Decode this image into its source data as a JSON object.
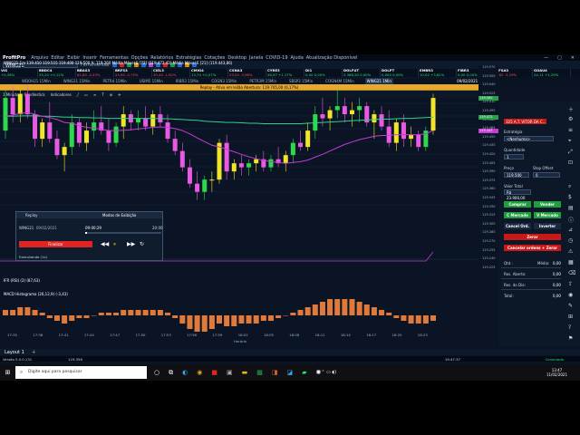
{
  "app": {
    "name": "ProfitPro",
    "menu": [
      "Arquivo",
      "Editar",
      "Exibir",
      "Inserir",
      "Ferramentas",
      "Opções",
      "Relatórios",
      "Estratégias",
      "Cotações",
      "Desktop",
      "Janela",
      "COVID-19",
      "Ajuda",
      "Atualização Disponível"
    ]
  },
  "toolbar": {
    "asset_value": "WING21",
    "workspace_label": "Ferramentas"
  },
  "ticker": [
    {
      "symbol": "VIS",
      "value": "+0,36%",
      "dir": "up"
    },
    {
      "symbol": "BBDC4",
      "value": "25,20 +0,12%",
      "dir": "up"
    },
    {
      "symbol": "BBAS3",
      "value": "62,80 -0,43%",
      "dir": "dn"
    },
    {
      "symbol": "BRFS3",
      "value": "23,90 -0,75%",
      "dir": "dn"
    },
    {
      "symbol": "CIEL3",
      "value": "30,40 -1,62%",
      "dir": "dn"
    },
    {
      "symbol": "CMIG4",
      "value": "13,74 +0,07%",
      "dir": "up"
    },
    {
      "symbol": "CSNA3",
      "value": "23,02 -3,98%",
      "dir": "dn"
    },
    {
      "symbol": "CYRE3",
      "value": "28,97 +1,17%",
      "dir": "up"
    },
    {
      "symbol": "DI1",
      "value": "0,00 0,00%",
      "dir": "up"
    },
    {
      "symbol": "DOLFUT",
      "value": "5.368,50 0,00%",
      "dir": "up"
    },
    {
      "symbol": "DOLPT",
      "value": "0,000 0,00%",
      "dir": "up"
    },
    {
      "symbol": "EMBR3",
      "value": "10,02 +3,62%",
      "dir": "up"
    },
    {
      "symbol": "FIBR3",
      "value": "0,00 0,00%",
      "dir": "up"
    },
    {
      "symbol": "GFSA3",
      "value": "5,62 -3,29%",
      "dir": "dn"
    },
    {
      "symbol": "GOAU4",
      "value": "24,11 +2,29%",
      "dir": "up"
    }
  ],
  "tabs": [
    "WDOH21 15Min",
    "WING21 15Min",
    "PETR4 15Min",
    "USIM5 15Min",
    "IRBR3 15Min",
    "COGN3 15Min",
    "PETR3M 15Min",
    "SBSP3 15Min",
    "COGN4M 15Min",
    "WING21 1Min"
  ],
  "active_tab": 9,
  "clock_header": "09/02/2021 10:24",
  "banner": "Replay - Ativo em leilão  Abertura: 119.705,00 (0,17%)",
  "chart_toolbar": {
    "interval": "1 Minuto",
    "style": "Candlestick",
    "indicators": "Indicadores"
  },
  "legend": "WING21 1m  119.410  119.515  119.400  119.500  A: 119.260  Média Móvel E [72]  (119.472,42)  Média Móvel E [21]  (119.443,86)",
  "price_labels": [
    "119.570",
    "119.555",
    "119.540",
    "119.525",
    "119.510",
    "119.495",
    "119.480",
    "119.465",
    "119.450",
    "119.435",
    "119.420",
    "119.405",
    "119.390",
    "119.375",
    "119.360",
    "119.345",
    "119.330",
    "119.315",
    "119.300",
    "119.285",
    "119.270",
    "119.255",
    "119.240",
    "119.225"
  ],
  "price_tags": {
    "last": "119.500",
    "ma72": "119.472",
    "ma21": "119.443"
  },
  "ifr_label": "IFR (RSI) (2) (87,63)",
  "macd_label": "MACD Histograma (26,12,9) (-3,43)",
  "time_labels": [
    "17:35",
    "17:38",
    "17:41",
    "17:44",
    "17:47",
    "17:50",
    "17:53",
    "17:56",
    "17:59",
    "18:02",
    "18:05",
    "18:08",
    "18:11",
    "18:14",
    "18:17",
    "18:20",
    "18:23"
  ],
  "time_axis_label": "Horário",
  "replay": {
    "title": "Replay",
    "mode": "Modos de Exibição",
    "asset": "WING21",
    "date": "09/02/2021",
    "time": "09:00:29",
    "end_time": "20:00",
    "finalize": "Finalizar",
    "executed": "Executando (1x)",
    "progress": 0.02
  },
  "side": {
    "account": "325 A.T. VITOR DA C...",
    "strategy_label": "Estratégia",
    "strategy_value": "<Nenhuma>",
    "qty_label": "Quantidade",
    "qty_value": "1",
    "price_label": "Preço",
    "price_value": "119.500",
    "stop_label": "Stop Offset",
    "stop_value": "0",
    "total_label": "Valor Total",
    "total_value": "R$ 23.900,00",
    "buy": "Comprar",
    "sell": "Vender",
    "buy_market": "C Mercado",
    "sell_market": "V Mercado",
    "cancel": "Cancel Ord.",
    "reverse": "Inverter",
    "zero": "Zerar",
    "cancel_zero": "Cancelar ordens + Zerar",
    "qty_row": "Qtd.:",
    "avg_label": "Médio:",
    "avg_value": "0,00",
    "open_label": "Res. Aberto:",
    "open_value": "0,00",
    "day_label": "Res. do Dia:",
    "day_value": "0,00",
    "total_row": "Total:",
    "total_row_value": "0,00"
  },
  "layout_bar": {
    "layout": "Layout 1"
  },
  "status": {
    "version": "Versão 5.0.0.131",
    "center": "119.356",
    "time": "19:47:37",
    "connection": "Conectado"
  },
  "taskbar": {
    "search": "Digite aqui para pesquisar",
    "time": "13:47",
    "date": "11/02/2021"
  },
  "colors": {
    "bull": "#f0e52a",
    "bear": "#e85ae2",
    "bull_body": "#2ed84d",
    "ma72": "#2fd18a",
    "ma21": "#c53bd3",
    "macd": "#e07a3a"
  },
  "chart_data": {
    "type": "candlestick",
    "y_range": [
      119225,
      119580
    ],
    "candles": [
      [
        119420,
        119520,
        119400,
        119500
      ],
      [
        119500,
        119530,
        119440,
        119460
      ],
      [
        119460,
        119520,
        119440,
        119510
      ],
      [
        119510,
        119530,
        119450,
        119460
      ],
      [
        119460,
        119470,
        119380,
        119400
      ],
      [
        119400,
        119450,
        119380,
        119440
      ],
      [
        119440,
        119490,
        119390,
        119400
      ],
      [
        119400,
        119420,
        119350,
        119360
      ],
      [
        119360,
        119390,
        119320,
        119380
      ],
      [
        119380,
        119460,
        119360,
        119440
      ],
      [
        119440,
        119450,
        119380,
        119390
      ],
      [
        119390,
        119440,
        119370,
        119420
      ],
      [
        119420,
        119470,
        119400,
        119440
      ],
      [
        119440,
        119480,
        119410,
        119420
      ],
      [
        119420,
        119450,
        119370,
        119390
      ],
      [
        119390,
        119440,
        119380,
        119430
      ],
      [
        119430,
        119480,
        119400,
        119460
      ],
      [
        119460,
        119470,
        119420,
        119440
      ],
      [
        119440,
        119470,
        119420,
        119450
      ],
      [
        119450,
        119480,
        119420,
        119430
      ],
      [
        119430,
        119470,
        119410,
        119460
      ],
      [
        119460,
        119480,
        119430,
        119440
      ],
      [
        119440,
        119460,
        119390,
        119400
      ],
      [
        119400,
        119420,
        119360,
        119370
      ],
      [
        119370,
        119390,
        119320,
        119330
      ],
      [
        119330,
        119350,
        119280,
        119290
      ],
      [
        119290,
        119320,
        119250,
        119270
      ],
      [
        119270,
        119310,
        119250,
        119300
      ],
      [
        119300,
        119320,
        119270,
        119300
      ],
      [
        119300,
        119400,
        119290,
        119390
      ],
      [
        119390,
        119410,
        119300,
        119320
      ],
      [
        119320,
        119350,
        119300,
        119340
      ],
      [
        119340,
        119360,
        119310,
        119330
      ],
      [
        119330,
        119350,
        119310,
        119340
      ],
      [
        119340,
        119360,
        119320,
        119350
      ],
      [
        119350,
        119370,
        119320,
        119330
      ],
      [
        119330,
        119360,
        119320,
        119350
      ],
      [
        119350,
        119380,
        119330,
        119340
      ],
      [
        119340,
        119370,
        119320,
        119360
      ],
      [
        119360,
        119400,
        119340,
        119390
      ],
      [
        119390,
        119420,
        119370,
        119380
      ],
      [
        119380,
        119440,
        119370,
        119420
      ],
      [
        119420,
        119480,
        119400,
        119460
      ],
      [
        119460,
        119500,
        119430,
        119450
      ],
      [
        119450,
        119480,
        119420,
        119470
      ],
      [
        119470,
        119520,
        119450,
        119480
      ],
      [
        119480,
        119500,
        119440,
        119460
      ],
      [
        119460,
        119490,
        119430,
        119470
      ],
      [
        119470,
        119500,
        119440,
        119480
      ],
      [
        119480,
        119490,
        119430,
        119440
      ],
      [
        119440,
        119470,
        119400,
        119460
      ],
      [
        119460,
        119480,
        119420,
        119430
      ],
      [
        119430,
        119470,
        119380,
        119390
      ],
      [
        119390,
        119450,
        119370,
        119440
      ],
      [
        119440,
        119460,
        119380,
        119400
      ],
      [
        119400,
        119430,
        119380,
        119410
      ],
      [
        119410,
        119420,
        119370,
        119380
      ],
      [
        119380,
        119430,
        119370,
        119420
      ],
      [
        119420,
        119510,
        119410,
        119500
      ]
    ],
    "ma72": [
      119455,
      119455,
      119456,
      119456,
      119456,
      119455,
      119455,
      119454,
      119453,
      119453,
      119452,
      119452,
      119451,
      119451,
      119450,
      119450,
      119450,
      119450,
      119450,
      119450,
      119450,
      119449,
      119449,
      119448,
      119447,
      119446,
      119445,
      119443,
      119442,
      119441,
      119440,
      119440,
      119439,
      119438,
      119438,
      119437,
      119437,
      119437,
      119437,
      119437,
      119437,
      119438,
      119439,
      119440,
      119441,
      119442,
      119443,
      119444,
      119445,
      119446,
      119447,
      119448,
      119448,
      119449,
      119450,
      119450,
      119451,
      119452,
      119453
    ],
    "ma21": [
      119455,
      119458,
      119462,
      119464,
      119460,
      119455,
      119452,
      119447,
      119440,
      119438,
      119432,
      119428,
      119426,
      119423,
      119420,
      119420,
      119421,
      119422,
      119424,
      119426,
      119428,
      119429,
      119428,
      119425,
      119420,
      119412,
      119402,
      119393,
      119384,
      119380,
      119374,
      119368,
      119362,
      119356,
      119351,
      119347,
      119344,
      119342,
      119340,
      119342,
      119344,
      119348,
      119355,
      119362,
      119370,
      119378,
      119386,
      119392,
      119398,
      119402,
      119406,
      119408,
      119408,
      119410,
      119410,
      119410,
      119410,
      119412,
      119420
    ],
    "macd": [
      2,
      2,
      3,
      3,
      2,
      1,
      -1,
      -2,
      -3,
      -2,
      -1,
      -1,
      0,
      1,
      1,
      1,
      2,
      2,
      2,
      2,
      2,
      2,
      1,
      -1,
      -3,
      -5,
      -6,
      -6,
      -5,
      -3,
      -4,
      -4,
      -3,
      -3,
      -3,
      -2,
      -2,
      -1,
      0,
      1,
      2,
      3,
      4,
      5,
      6,
      6,
      6,
      6,
      5,
      4,
      3,
      2,
      1,
      -1,
      -2,
      -3,
      -3,
      -3,
      -2
    ]
  }
}
